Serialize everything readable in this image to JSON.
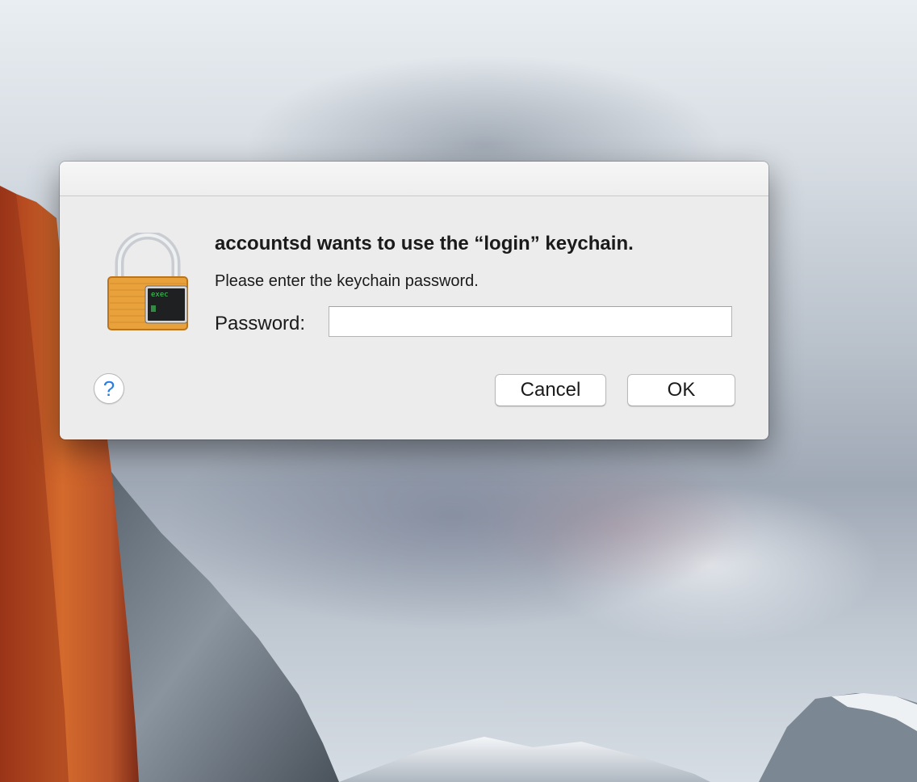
{
  "dialog": {
    "headline": "accountsd wants to use the “login” keychain.",
    "message": "Please enter the keychain password.",
    "password_label": "Password:",
    "password_value": "",
    "help_label": "?",
    "cancel_label": "Cancel",
    "ok_label": "OK",
    "icon": "keychain-lock-icon",
    "icon_badge_text": "exec"
  },
  "colors": {
    "help_accent": "#2a7de1",
    "dialog_background": "#ececec",
    "lock_gold": "#e9a23b",
    "terminal_text": "#3fd45a"
  }
}
